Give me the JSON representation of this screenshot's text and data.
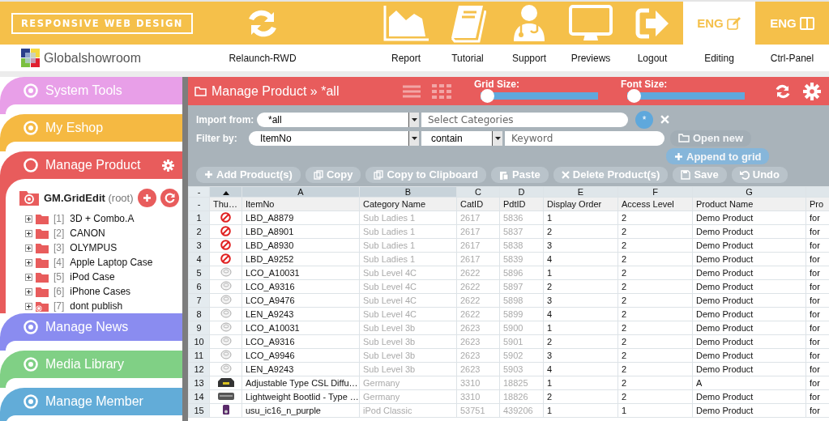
{
  "header": {
    "brand": "RESPONSIVE WEB DESIGN",
    "logo_text": "Globalshowroom",
    "nav": [
      {
        "kind": "refresh",
        "label": "Relaunch-RWD",
        "selected": false
      },
      {
        "kind": "chart",
        "label": "Report",
        "selected": false
      },
      {
        "kind": "book",
        "label": "Tutorial",
        "selected": false
      },
      {
        "kind": "doctor",
        "label": "Support",
        "selected": false
      },
      {
        "kind": "monitor",
        "label": "Previews",
        "selected": false
      },
      {
        "kind": "logout",
        "label": "Logout",
        "selected": false
      },
      {
        "kind": "edit",
        "badge": "ENG",
        "label": "Editing",
        "selected": true
      },
      {
        "kind": "panel",
        "badge": "ENG",
        "label": "Ctrl-Panel",
        "selected": false
      }
    ]
  },
  "sidebar": {
    "sections": [
      {
        "title": "System Tools",
        "color": "#e89fe8",
        "expanded": false
      },
      {
        "title": "My Eshop",
        "color": "#f5b942",
        "expanded": false
      },
      {
        "title": "Manage Product",
        "color": "#e85c5c",
        "expanded": true
      },
      {
        "title": "Manage News",
        "color": "#8a8cf0",
        "expanded": false
      },
      {
        "title": "Media Library",
        "color": "#80d085",
        "expanded": false
      },
      {
        "title": "Manage Member",
        "color": "#62acd8",
        "expanded": false
      }
    ],
    "tree": {
      "root": "GM.GridEdit",
      "root_note": "(root)",
      "items": [
        {
          "index": "[1]",
          "label": "3D + Combo.A",
          "expanded": false,
          "kind": "folder"
        },
        {
          "index": "[2]",
          "label": "CANON",
          "expanded": false,
          "kind": "folder"
        },
        {
          "index": "[3]",
          "label": "OLYMPUS",
          "expanded": false,
          "kind": "folder"
        },
        {
          "index": "[4]",
          "label": "Apple Laptop Case",
          "expanded": false,
          "kind": "folder"
        },
        {
          "index": "[5]",
          "label": "iPod Case",
          "expanded": false,
          "kind": "folder"
        },
        {
          "index": "[6]",
          "label": "iPhone Cases",
          "expanded": false,
          "kind": "folder"
        },
        {
          "index": "[7]",
          "label": "dont publish",
          "expanded": false,
          "kind": "hidden"
        }
      ]
    }
  },
  "panel": {
    "title": "Manage Product » *all",
    "sliders": [
      {
        "label": "Grid Size:",
        "level": 0
      },
      {
        "label": "Font Size:",
        "level": 0
      }
    ],
    "import": {
      "label": "Import from:",
      "source": "*all",
      "placeholder": "Select Categories",
      "button": "*"
    },
    "filter": {
      "label": "Filter by:",
      "field": "ItemNo",
      "operator": "contain",
      "placeholder": "Keyword"
    },
    "side_buttons": [
      {
        "kind": "open",
        "label": "Open new",
        "disabled": true
      },
      {
        "kind": "add",
        "label": "Append to grid",
        "disabled": true
      }
    ],
    "buttons": [
      {
        "kind": "add",
        "label": "Add Product(s)",
        "disabled": false
      },
      {
        "kind": "copy",
        "label": "Copy",
        "disabled": false
      },
      {
        "kind": "copy",
        "label": "Copy to Clipboard",
        "disabled": false
      },
      {
        "kind": "paste",
        "label": "Paste",
        "disabled": false
      },
      {
        "kind": "delete",
        "label": "Delete Product(s)",
        "disabled": false
      },
      {
        "kind": "save",
        "label": "Save",
        "disabled": false
      },
      {
        "kind": "undo",
        "label": "Undo",
        "disabled": false
      }
    ]
  },
  "table": {
    "columns": [
      {
        "kind": "plain",
        "letter": "-",
        "label": "-",
        "selected": false
      },
      {
        "kind": "sorted",
        "label": "Thu…",
        "selected": true
      },
      {
        "kind": "plain",
        "letter": "A",
        "label": "ItemNo",
        "selected": true,
        "readonly": false
      },
      {
        "kind": "plain",
        "letter": "B",
        "label": "Category Name",
        "selected": true,
        "readonly": true
      },
      {
        "kind": "plain",
        "letter": "C",
        "label": "CatID",
        "selected": false,
        "readonly": true
      },
      {
        "kind": "plain",
        "letter": "D",
        "label": "PdtID",
        "selected": false,
        "readonly": true
      },
      {
        "kind": "plain",
        "letter": "E",
        "label": "Display Order",
        "selected": false,
        "readonly": false
      },
      {
        "kind": "plain",
        "letter": "F",
        "label": "Access Level",
        "selected": false,
        "readonly": false
      },
      {
        "kind": "plain",
        "letter": "G",
        "label": "Product Name",
        "selected": false,
        "readonly": false
      },
      {
        "kind": "plain",
        "label": "Pro",
        "selected": false,
        "readonly": false
      }
    ],
    "rows": [
      {
        "kind": "blocked",
        "cells": [
          "1",
          "",
          "LBD_A8879",
          "Sub Ladies 1",
          "2617",
          "5836",
          "1",
          "2",
          "Demo Product",
          "for"
        ]
      },
      {
        "kind": "blocked",
        "cells": [
          "2",
          "",
          "LBD_A8901",
          "Sub Ladies 1",
          "2617",
          "5837",
          "2",
          "2",
          "Demo Product",
          "for"
        ]
      },
      {
        "kind": "blocked",
        "cells": [
          "3",
          "",
          "LBD_A8930",
          "Sub Ladies 1",
          "2617",
          "5838",
          "3",
          "2",
          "Demo Product",
          "for"
        ]
      },
      {
        "kind": "blocked",
        "cells": [
          "4",
          "",
          "LBD_A9252",
          "Sub Ladies 1",
          "2617",
          "5839",
          "4",
          "2",
          "Demo Product",
          "for"
        ]
      },
      {
        "kind": "ring",
        "cells": [
          "5",
          "",
          "LCO_A10031",
          "Sub Level 4C",
          "2622",
          "5896",
          "1",
          "2",
          "Demo Product",
          "for"
        ]
      },
      {
        "kind": "ring",
        "cells": [
          "6",
          "",
          "LCO_A9316",
          "Sub Level 4C",
          "2622",
          "5897",
          "2",
          "2",
          "Demo Product",
          "for"
        ]
      },
      {
        "kind": "ring",
        "cells": [
          "7",
          "",
          "LCO_A9476",
          "Sub Level 4C",
          "2622",
          "5898",
          "3",
          "2",
          "Demo Product",
          "for"
        ]
      },
      {
        "kind": "ring",
        "cells": [
          "8",
          "",
          "LEN_A9243",
          "Sub Level 4C",
          "2622",
          "5899",
          "4",
          "2",
          "Demo Product",
          "for"
        ]
      },
      {
        "kind": "ring",
        "cells": [
          "9",
          "",
          "LCO_A10031",
          "Sub Level 3b",
          "2623",
          "5900",
          "1",
          "2",
          "Demo Product",
          "for"
        ]
      },
      {
        "kind": "ring",
        "cells": [
          "10",
          "",
          "LCO_A9316",
          "Sub Level 3b",
          "2623",
          "5901",
          "2",
          "2",
          "Demo Product",
          "for"
        ]
      },
      {
        "kind": "ring",
        "cells": [
          "11",
          "",
          "LCO_A9946",
          "Sub Level 3b",
          "2623",
          "5902",
          "3",
          "2",
          "Demo Product",
          "for"
        ]
      },
      {
        "kind": "ring",
        "cells": [
          "12",
          "",
          "LEN_A9243",
          "Sub Level 3b",
          "2623",
          "5903",
          "4",
          "2",
          "Demo Product",
          "for"
        ]
      },
      {
        "kind": "car",
        "cells": [
          "13",
          "",
          "Adjustable Type CSL Diffu…",
          "Germany",
          "3310",
          "18825",
          "1",
          "2",
          "A",
          "for"
        ]
      },
      {
        "kind": "lid",
        "cells": [
          "14",
          "",
          "Lightweight Bootlid - Type …",
          "Germany",
          "3310",
          "18826",
          "2",
          "2",
          "Demo Product",
          "for"
        ]
      },
      {
        "kind": "player",
        "cells": [
          "15",
          "",
          "usu_ic16_n_purple",
          "iPod Classic",
          "53751",
          "439206",
          "1",
          "1",
          "Demo Product",
          "for"
        ]
      }
    ]
  }
}
